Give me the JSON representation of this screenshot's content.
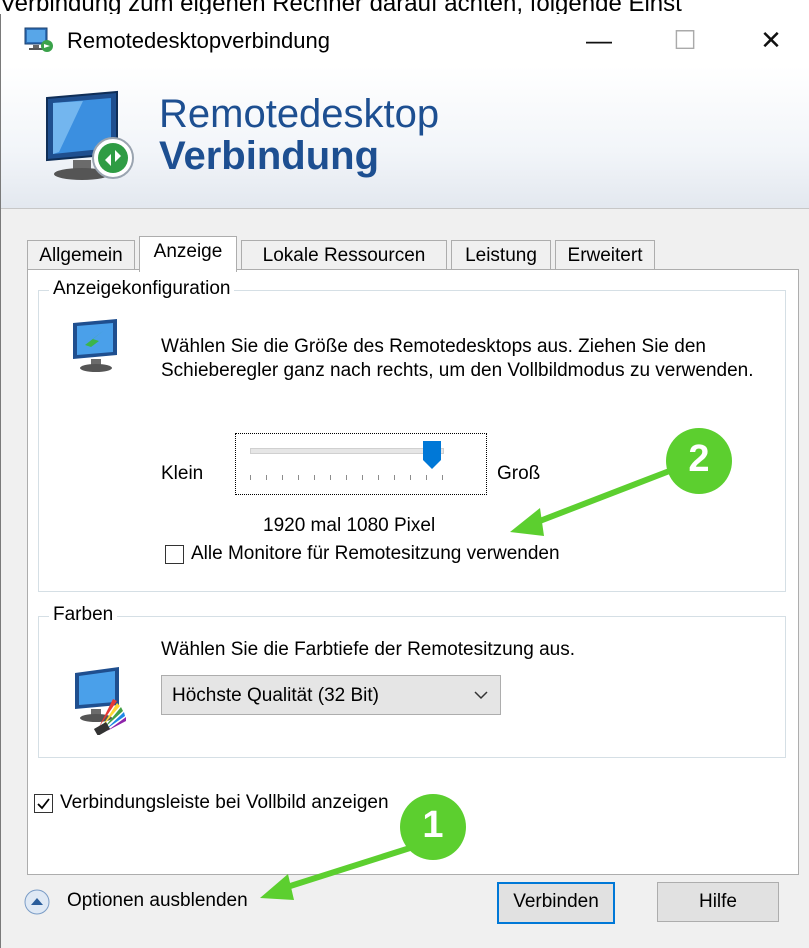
{
  "page_top_text": "Verbindung zum eigenen Rechner darauf achten, folgende Einst",
  "window": {
    "title": "Remotedesktopverbindung",
    "controls": {
      "minimize": "—",
      "maximize": "☐",
      "close": "✕"
    }
  },
  "banner": {
    "line1": "Remotedesktop",
    "line2": "Verbindung"
  },
  "tabs": [
    {
      "label": "Allgemein",
      "active": false
    },
    {
      "label": "Anzeige",
      "active": true
    },
    {
      "label": "Lokale Ressourcen",
      "active": false
    },
    {
      "label": "Leistung",
      "active": false
    },
    {
      "label": "Erweitert",
      "active": false
    }
  ],
  "display_config": {
    "legend": "Anzeigekonfiguration",
    "description": "Wählen Sie die Größe des Remotedesktops aus. Ziehen Sie den Schieberegler ganz nach rechts, um den Vollbildmodus zu verwenden.",
    "slider_min_label": "Klein",
    "slider_max_label": "Groß",
    "slider_fraction": 0.95,
    "resolution_text": "1920 mal 1080 Pixel",
    "all_monitors_label": "Alle Monitore für Remotesitzung verwenden",
    "all_monitors_checked": false
  },
  "colors_group": {
    "legend": "Farben",
    "description": "Wählen Sie die Farbtiefe der Remotesitzung aus.",
    "selected_value": "Höchste Qualität (32 Bit)"
  },
  "connection_bar": {
    "label": "Verbindungsleiste bei Vollbild anzeigen",
    "checked": true
  },
  "footer": {
    "options_label": "Optionen ausblenden",
    "connect_button": "Verbinden",
    "help_button": "Hilfe"
  },
  "annotations": [
    {
      "label": "1"
    },
    {
      "label": "2"
    }
  ],
  "colors": {
    "accent": "#0078d7",
    "banner_text": "#1d4f91",
    "annotation_green": "#5ccf2f"
  }
}
